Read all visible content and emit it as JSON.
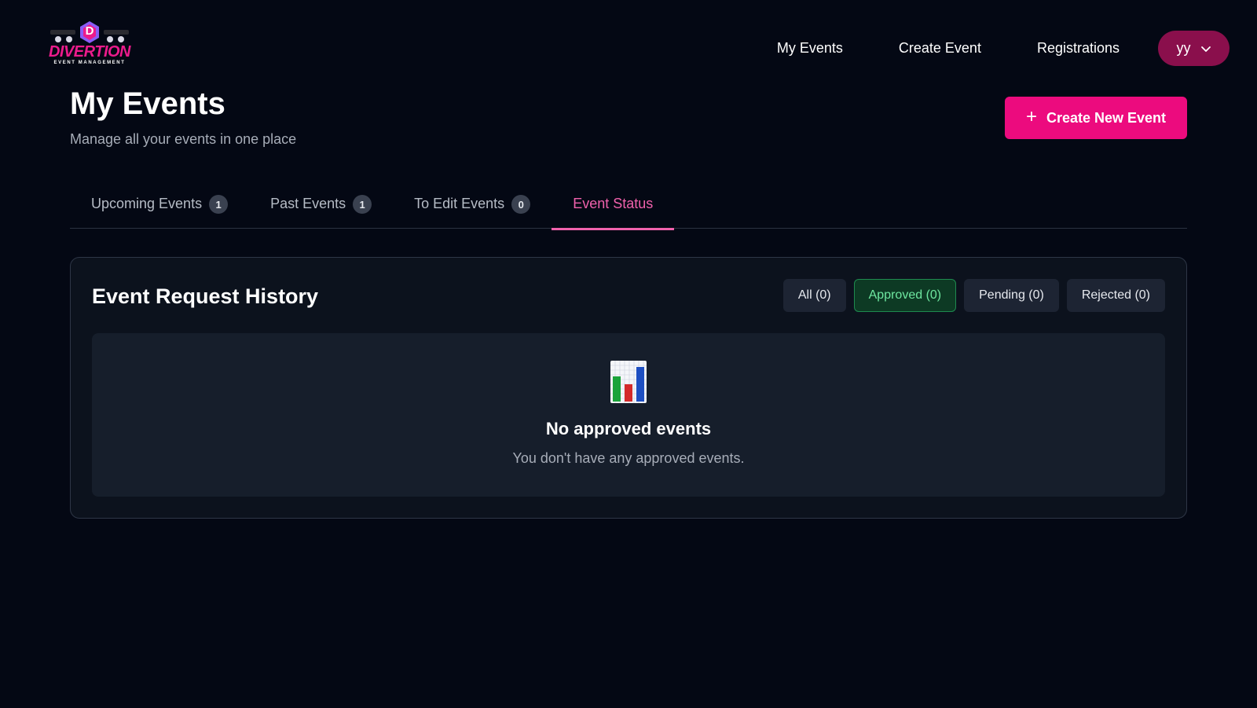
{
  "brand": {
    "logo_letter": "D",
    "logo_name": "DIVERTION",
    "logo_tagline": "EVENT MANAGEMENT",
    "accent": "#ec0b7e"
  },
  "nav": {
    "items": [
      {
        "label": "My Events"
      },
      {
        "label": "Create Event"
      },
      {
        "label": "Registrations"
      }
    ],
    "user": {
      "initials": "yy",
      "icon": "chevron-down-icon"
    }
  },
  "page": {
    "title": "My Events",
    "subtitle": "Manage all your events in one place",
    "create_button": {
      "icon": "plus-icon",
      "label": "Create New Event"
    }
  },
  "tabs": [
    {
      "label": "Upcoming Events",
      "count": "1",
      "active": false
    },
    {
      "label": "Past Events",
      "count": "1",
      "active": false
    },
    {
      "label": "To Edit Events",
      "count": "0",
      "active": false
    },
    {
      "label": "Event Status",
      "count": null,
      "active": true
    }
  ],
  "history": {
    "title": "Event Request History",
    "filters": [
      {
        "label": "All (0)",
        "active": false
      },
      {
        "label": "Approved (0)",
        "active": true
      },
      {
        "label": "Pending (0)",
        "active": false
      },
      {
        "label": "Rejected (0)",
        "active": false
      }
    ],
    "empty": {
      "icon": "bar-chart-icon",
      "title": "No approved events",
      "text": "You don't have any approved events."
    }
  }
}
